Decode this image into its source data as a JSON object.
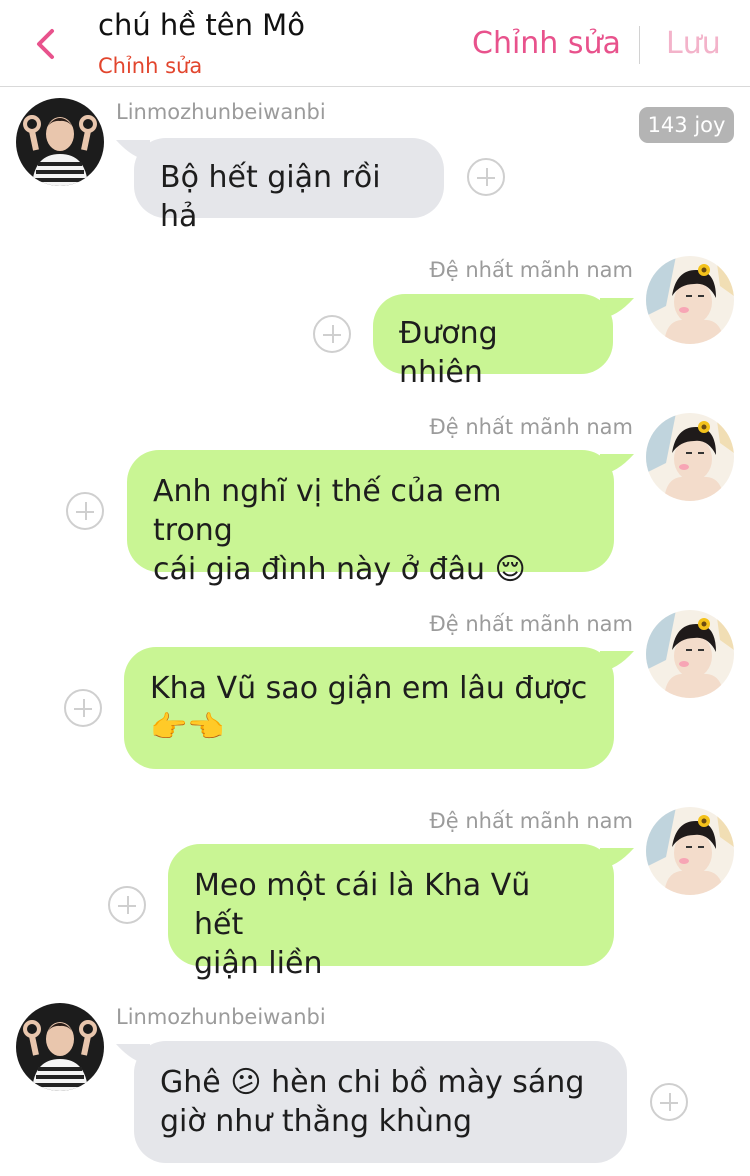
{
  "header": {
    "title": "chú hề tên Mô",
    "subtitle": "Chỉnh sửa",
    "edit_label": "Chỉnh sửa",
    "save_label": "Lưu",
    "accent": "#e8528c",
    "subtitle_color": "#e2452d"
  },
  "badge": {
    "text": "143 joy"
  },
  "colors": {
    "gray_bubble": "#e5e6ea",
    "green_bubble": "#c9f594"
  },
  "messages": [
    {
      "sender": "Linmozhunbeiwanbi",
      "side": "left",
      "line1": "Bộ hết giận rồi hả",
      "line2": ""
    },
    {
      "sender": "Đệ nhất mãnh nam",
      "side": "right",
      "line1": "Đương nhiên",
      "line2": ""
    },
    {
      "sender": "Đệ nhất mãnh nam",
      "side": "right",
      "line1": "Anh nghĩ vị thế của em trong",
      "line2": "cái gia đình này ở đâu 😌"
    },
    {
      "sender": "Đệ nhất mãnh nam",
      "side": "right",
      "line1": "Kha Vũ sao giận em lâu được",
      "line2": "👉👈"
    },
    {
      "sender": "Đệ nhất mãnh nam",
      "side": "right",
      "line1": "Meo một cái là Kha Vũ hết",
      "line2": "giận liền"
    },
    {
      "sender": "Linmozhunbeiwanbi",
      "side": "left",
      "line1": "Ghê 😕 hèn chi bồ mày sáng",
      "line2": "giờ như thằng khùng"
    }
  ]
}
